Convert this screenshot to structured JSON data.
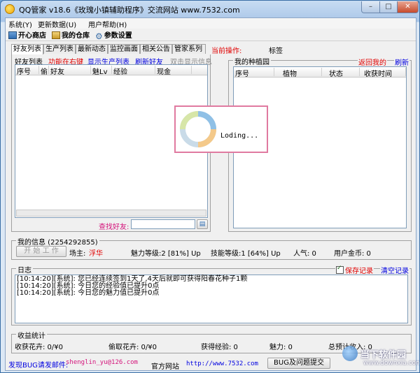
{
  "window": {
    "title": "QQ管家 v18.6《玫瑰小镇辅助程序》交流网站 www.7532.com",
    "min": "–",
    "max": "□",
    "close": "✕"
  },
  "menu": [
    "系统(Y)",
    "更新数据(U)",
    "用户帮助(H)"
  ],
  "toolbar": {
    "shop": "开心商店",
    "warehouse": "我的仓库",
    "settings": "参数设置"
  },
  "tabs": [
    "好友列表",
    "生产列表",
    "最新动态",
    "监控画面",
    "相关公告",
    "管家系列"
  ],
  "current_op": {
    "label": "当前操作:",
    "tag": "标签"
  },
  "friends": {
    "title": "好友列表",
    "actions": [
      "功能在右键",
      "显示生产列表",
      "刷新好友",
      "双击显示信息"
    ],
    "columns": [
      "序号",
      "偷",
      "好友",
      "魅Lv",
      "经验",
      "现金"
    ],
    "search_label": "查找好友:",
    "search_value": ""
  },
  "garden": {
    "title": "我的种植园",
    "return_link": "返回我的",
    "refresh_link": "刷新",
    "columns": [
      "序号",
      "植物",
      "状态",
      "收获时间"
    ]
  },
  "loading": {
    "text": "Loding..."
  },
  "myinfo": {
    "title": "我的信息 (2254292855)",
    "start_button": "开 始 工 作",
    "farm_owner_label": "场主:",
    "farm_owner": "浮华",
    "charm": "魅力等级:2 [81%] Up",
    "skill": "技能等级:1 [64%] Up",
    "popularity": "人气: 0",
    "gold": "用户金币: 0"
  },
  "log": {
    "title": "日志",
    "save_label": "保存记录",
    "clear_link": "清空记录",
    "lines": [
      "[10:14:20][系统]: 您已经连续签到1天了,4天后就即可获得阳春花种子1颗",
      "[10:14:20][系统]: 今日您的经验值已提升0点",
      "[10:14:20][系统]: 今日您的魅力值已提升0点"
    ]
  },
  "stats": {
    "title": "收益统计",
    "harvest": "收获花卉: 0/¥0",
    "steal": "偷取花卉: 0/¥0",
    "exp": "获得经验: 0",
    "charm": "魅力: 0",
    "total": "总预计收入: 0"
  },
  "footer": {
    "bug_label": "发现BUG请发邮件:",
    "email": "shenglin_yu@126.com",
    "site_label": "官方网站",
    "site_url": "http://www.7532.com",
    "bug_button": "BUG及问题提交"
  },
  "watermark": {
    "name": "当下软件园",
    "url": "www.downxia.com"
  },
  "colors": {
    "accent": "#0000e0",
    "alert": "#e00000",
    "loading_border": "#e07aa0"
  }
}
